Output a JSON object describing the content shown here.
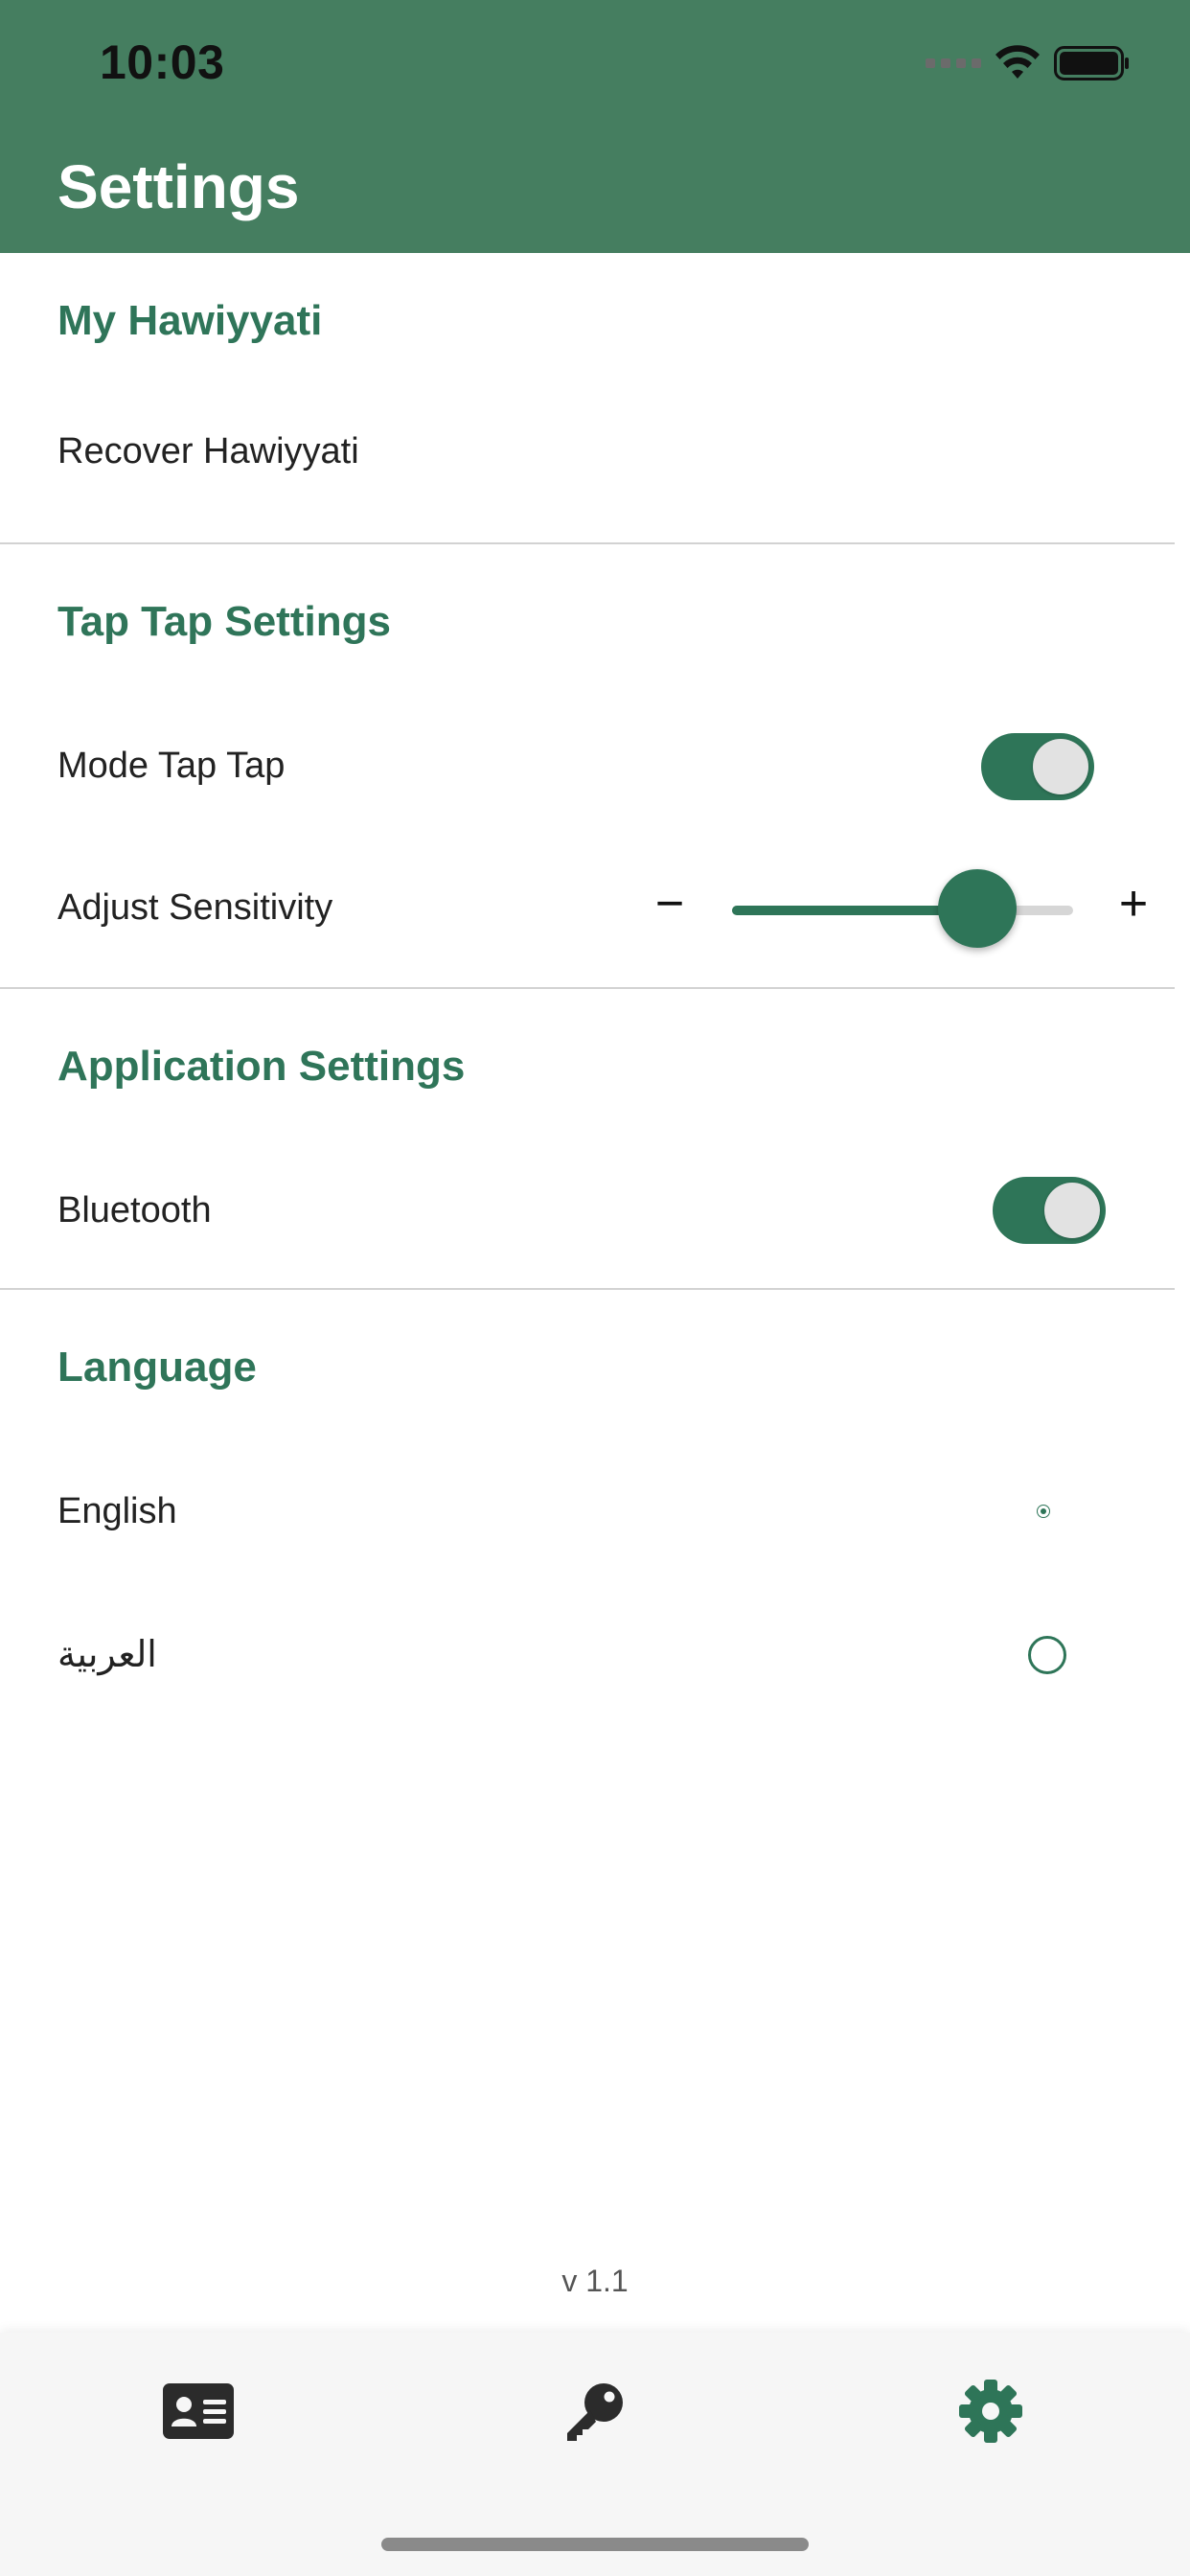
{
  "status_bar": {
    "time": "10:03",
    "icons": [
      "signal-icon",
      "wifi-icon",
      "battery-icon"
    ]
  },
  "header": {
    "title": "Settings",
    "background_color": "#457e60"
  },
  "sections": {
    "my_hawiyyati": {
      "title": "My Hawiyyati",
      "recover_label": "Recover Hawiyyati"
    },
    "tap_tap": {
      "title": "Tap Tap Settings",
      "mode_label": "Mode Tap Tap",
      "mode_enabled": true,
      "sensitivity_label": "Adjust Sensitivity",
      "sensitivity_value": 0.72,
      "minus_symbol": "−",
      "plus_symbol": "+"
    },
    "application": {
      "title": "Application Settings",
      "bluetooth_label": "Bluetooth",
      "bluetooth_enabled": true
    },
    "language": {
      "title": "Language",
      "options": [
        {
          "label": "English",
          "selected": true
        },
        {
          "label": "العربية",
          "selected": false
        }
      ]
    }
  },
  "version": "v 1.1",
  "tab_bar": {
    "tabs": [
      {
        "icon": "id-card-icon",
        "active": false
      },
      {
        "icon": "key-icon",
        "active": false
      },
      {
        "icon": "gear-icon",
        "active": true
      }
    ]
  },
  "colors": {
    "accent": "#2e7558",
    "section_title": "#2f7559",
    "inactive_icon": "#2b2b2b"
  }
}
